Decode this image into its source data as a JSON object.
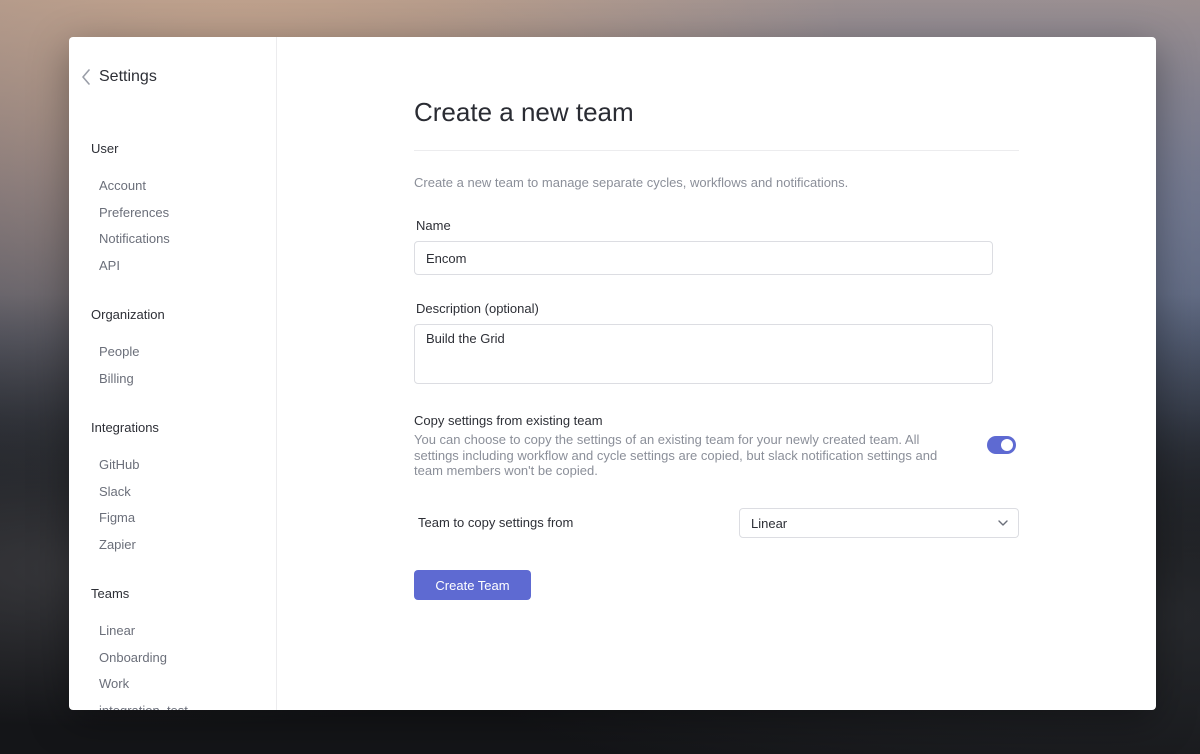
{
  "sidebar": {
    "back_label": "Settings",
    "sections": [
      {
        "title": "User",
        "items": [
          "Account",
          "Preferences",
          "Notifications",
          "API"
        ]
      },
      {
        "title": "Organization",
        "items": [
          "People",
          "Billing"
        ]
      },
      {
        "title": "Integrations",
        "items": [
          "GitHub",
          "Slack",
          "Figma",
          "Zapier"
        ]
      },
      {
        "title": "Teams",
        "items": [
          "Linear",
          "Onboarding",
          "Work",
          "integration_test"
        ]
      }
    ]
  },
  "main": {
    "title": "Create a new team",
    "intro": "Create a new team to manage separate cycles, workflows and notifications.",
    "name_label": "Name",
    "name_value": "Encom",
    "description_label": "Description (optional)",
    "description_value": "Build the Grid",
    "copy_title": "Copy settings from existing team",
    "copy_description": "You can choose to copy the settings of an existing team for your newly created team. All settings including workflow and cycle settings are copied, but slack notification settings and team members won't be copied.",
    "copy_toggle_on": true,
    "select_label": "Team to copy settings from",
    "select_value": "Linear",
    "submit_label": "Create Team"
  },
  "colors": {
    "accent": "#5e6ad2",
    "muted_text": "#8b8f99",
    "primary_text": "#2d2f36"
  }
}
